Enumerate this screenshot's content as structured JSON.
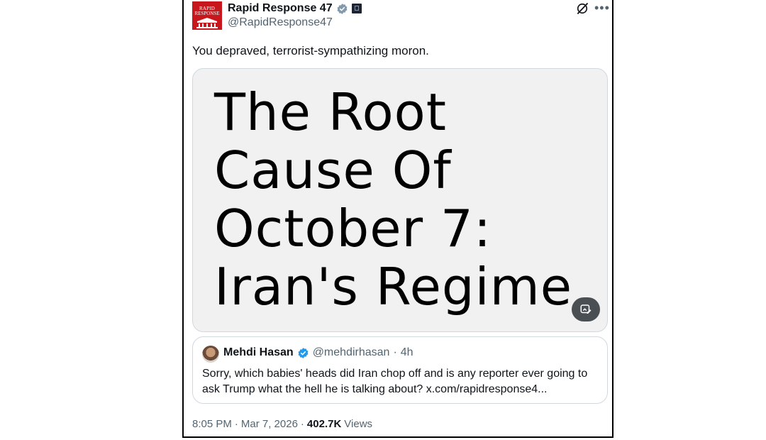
{
  "author": {
    "avatar_line1": "RAPID",
    "avatar_line2": "RESPONSE",
    "display_name": "Rapid Response 47",
    "handle": "@RapidResponse47"
  },
  "tweet": {
    "text": "You depraved, terrorist-sympathizing moron.",
    "media_text": "The Root\nCause Of\nOctober 7:\nIran's Regime"
  },
  "quoted": {
    "display_name": "Mehdi Hasan",
    "handle": "@mehdirhasan",
    "separator": "·",
    "time": "4h",
    "text": "Sorry, which babies' heads did Iran chop off and is any reporter ever going to ask Trump what the hell he is talking about? x.com/rapidresponse4..."
  },
  "meta": {
    "time": "8:05 PM",
    "dot1": "·",
    "date": "Mar 7, 2026",
    "dot2": "·",
    "views_count": "402.7K",
    "views_label": "Views"
  },
  "icons": {
    "verified": "verified-badge-icon",
    "gov": "government-affiliation-icon",
    "grok": "grok-icon",
    "more": "more-icon",
    "alt": "alt-image-icon"
  },
  "colors": {
    "verified": "#1d9bf0",
    "brand_red": "#c8161d",
    "secondary_text": "#536471"
  }
}
